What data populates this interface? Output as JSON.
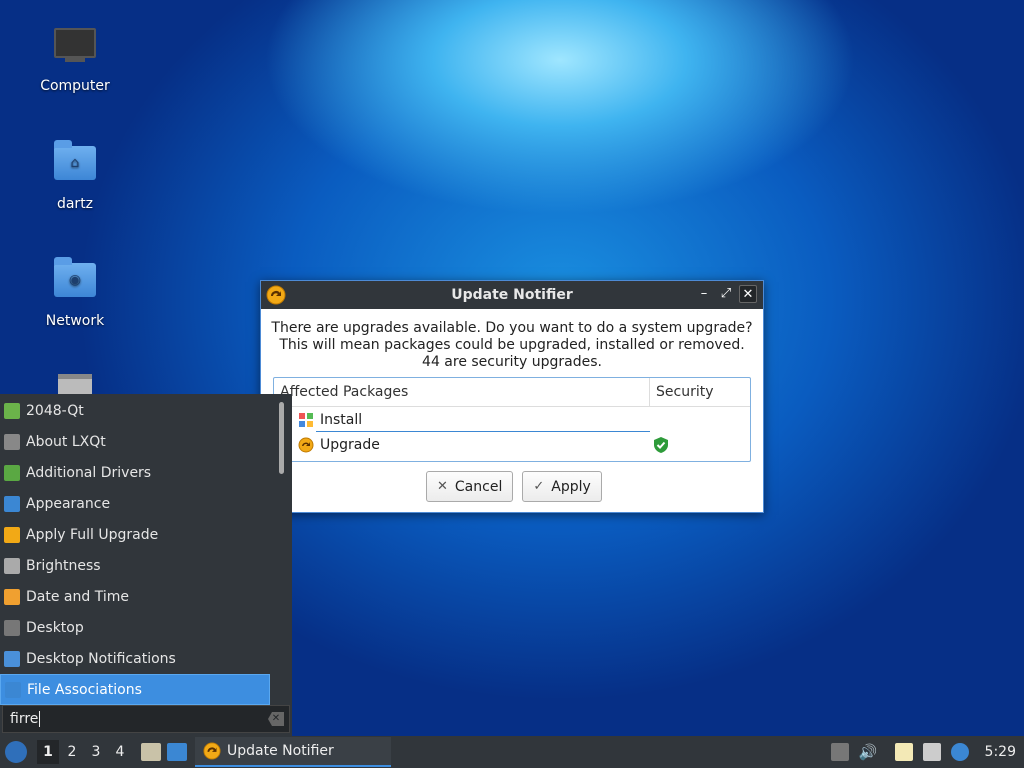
{
  "desktop": {
    "icons": [
      {
        "label": "Computer"
      },
      {
        "label": "dartz"
      },
      {
        "label": "Network"
      },
      {
        "label": "Trash"
      }
    ]
  },
  "dialog": {
    "title": "Update Notifier",
    "message_lines": [
      "There are upgrades available. Do you want to do a system upgrade?",
      "This will mean packages could be upgraded, installed or removed.",
      "44 are security upgrades."
    ],
    "table": {
      "headers": [
        "Affected Packages",
        "Security"
      ],
      "rows": [
        {
          "label": "Install",
          "security": false
        },
        {
          "label": "Upgrade",
          "security": true
        }
      ]
    },
    "buttons": {
      "cancel": "Cancel",
      "apply": "Apply"
    },
    "controls": {
      "minimize": "–",
      "maximize": "⤢",
      "close": "✕"
    }
  },
  "menu": {
    "items": [
      {
        "label": "2048-Qt",
        "icon": "2048-icon",
        "color": "#6bb34a"
      },
      {
        "label": "About LXQt",
        "icon": "info-icon",
        "color": "#888888"
      },
      {
        "label": "Additional Drivers",
        "icon": "chip-icon",
        "color": "#5aa843"
      },
      {
        "label": "Appearance",
        "icon": "monitor-icon",
        "color": "#3b87d3"
      },
      {
        "label": "Apply Full Upgrade",
        "icon": "upgrade-icon",
        "color": "#f2a916"
      },
      {
        "label": "Brightness",
        "icon": "brightness-icon",
        "color": "#aaaaaa"
      },
      {
        "label": "Date and Time",
        "icon": "clock-icon",
        "color": "#f0a030"
      },
      {
        "label": "Desktop",
        "icon": "desktop-icon",
        "color": "#777777"
      },
      {
        "label": "Desktop Notifications",
        "icon": "notification-icon",
        "color": "#4a90d9"
      },
      {
        "label": "File Associations",
        "icon": "gear-icon",
        "color": "#3b87d3",
        "active": true
      }
    ],
    "search_value": "firre"
  },
  "taskbar": {
    "desktops": [
      "1",
      "2",
      "3",
      "4"
    ],
    "task_label": "Update Notifier",
    "clock": "5:29"
  },
  "colors": {
    "accent": "#3d8ee0",
    "panel": "#31363b",
    "security_green": "#2e9b3a"
  }
}
